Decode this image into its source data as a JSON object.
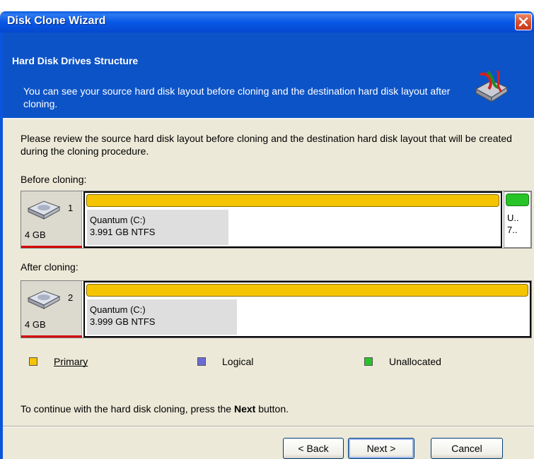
{
  "window": {
    "title": "Disk Clone Wizard"
  },
  "header": {
    "title": "Hard Disk Drives Structure",
    "description": "You can see your source hard disk layout before cloning and the destination hard disk layout after cloning."
  },
  "intro": "Please review the source hard disk layout before cloning and the destination hard disk layout that will be created during the cloning procedure.",
  "before": {
    "label": "Before cloning:",
    "disk_number": "1",
    "disk_size": "4 GB",
    "partition_name": "Quantum (C:)",
    "partition_detail": "3.991 GB  NTFS",
    "unalloc_line1": "U..",
    "unalloc_line2": "7.."
  },
  "after": {
    "label": "After cloning:",
    "disk_number": "2",
    "disk_size": "4 GB",
    "partition_name": "Quantum (C:)",
    "partition_detail": "3.999 GB  NTFS"
  },
  "legend": [
    {
      "label": "Primary",
      "color": "#f5c400"
    },
    {
      "label": "Logical",
      "color": "#6b6bd6"
    },
    {
      "label": "Unallocated",
      "color": "#27c427"
    }
  ],
  "footer": {
    "text_before": "To continue with the hard disk cloning, press the ",
    "text_bold": "Next",
    "text_after": " button."
  },
  "buttons": {
    "back": "< Back",
    "next": "Next >",
    "cancel": "Cancel"
  },
  "colors": {
    "primary_bar": "#f5c400",
    "unallocated_bar": "#27c427",
    "header_bg": "#0c53c7"
  }
}
